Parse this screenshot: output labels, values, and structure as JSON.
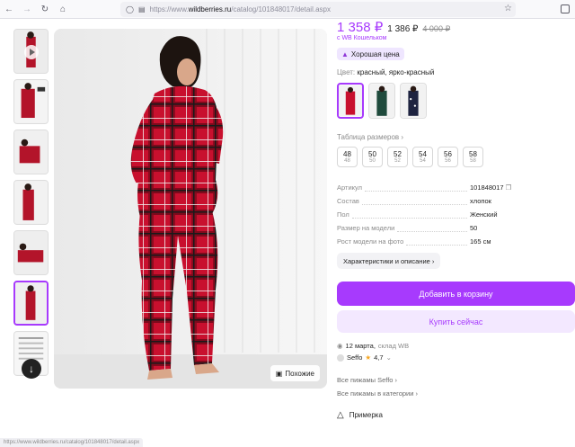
{
  "browser": {
    "url_prefix": "https://www.",
    "url_domain": "wildberries.ru",
    "url_path": "/catalog/101848017/detail.aspx",
    "status_url": "https://www.wildberries.ru/catalog/101848017/detail.aspx"
  },
  "icons": [
    "back-icon",
    "forward-icon",
    "reload-icon",
    "home-icon",
    "shield-icon",
    "lock-icon",
    "star-icon",
    "play-icon",
    "arrow-down-icon",
    "similar-icon",
    "thumb-up-icon",
    "copy-icon",
    "delivery-icon",
    "hanger-icon"
  ],
  "price": {
    "current": "1 358 ₽",
    "wallet_price": "1 386 ₽",
    "old": "4 000 ₽",
    "wallet_note": "с WB Кошельком"
  },
  "badge": {
    "label": "Хорошая цена"
  },
  "color": {
    "label": "Цвет:",
    "value": "красный, ярко-красный"
  },
  "sizes": {
    "link": "Таблица размеров",
    "items": [
      {
        "size": "48",
        "ru": "48"
      },
      {
        "size": "50",
        "ru": "50"
      },
      {
        "size": "52",
        "ru": "52"
      },
      {
        "size": "54",
        "ru": "54"
      },
      {
        "size": "56",
        "ru": "56"
      },
      {
        "size": "58",
        "ru": "58"
      }
    ]
  },
  "specs": [
    {
      "k": "Артикул",
      "v": "101848017"
    },
    {
      "k": "Состав",
      "v": "хлопок"
    },
    {
      "k": "Пол",
      "v": "Женский"
    },
    {
      "k": "Размер на модели",
      "v": "50"
    },
    {
      "k": "Рост модели на фото",
      "v": "165 см"
    }
  ],
  "buttons": {
    "chars": "Характеристики и описание",
    "cart": "Добавить в корзину",
    "buy": "Купить сейчас",
    "similar": "Похожие"
  },
  "delivery": {
    "date": "12 марта,",
    "warehouse": "склад WB"
  },
  "seller": {
    "name": "Seffo",
    "rating": "4,7"
  },
  "links": {
    "all_seller": "Все пижамы Seffo",
    "all_category": "Все пижамы в категории"
  },
  "fitting": {
    "label": "Примерка"
  },
  "colors": {
    "accent": "#a73afd",
    "accent_light": "#f3e8ff",
    "plaid_red": "#c8102e"
  }
}
